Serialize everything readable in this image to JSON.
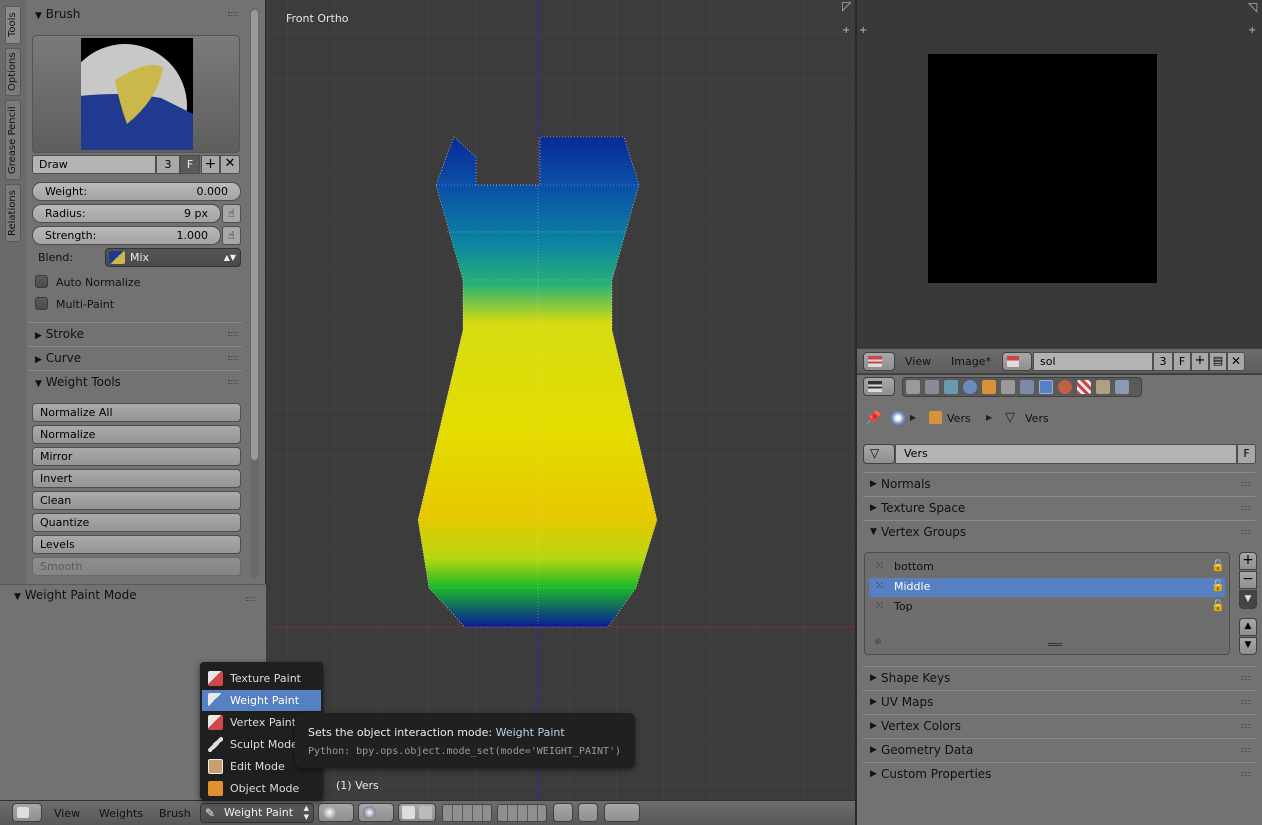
{
  "tool_shelf": {
    "tabs": [
      "Tools",
      "Options",
      "Grease Pencil",
      "Relations"
    ],
    "brush_panel": {
      "title": "Brush",
      "brush_name": "Draw",
      "users": "3",
      "fake_user": "F",
      "weight_label": "Weight:",
      "weight_value": "0.000",
      "radius_label": "Radius:",
      "radius_value": "9 px",
      "strength_label": "Strength:",
      "strength_value": "1.000",
      "blend_label": "Blend:",
      "blend_value": "Mix",
      "auto_normalize": "Auto Normalize",
      "multi_paint": "Multi-Paint"
    },
    "stroke_panel": "Stroke",
    "curve_panel": "Curve",
    "weight_tools_panel": {
      "title": "Weight Tools",
      "buttons": [
        "Normalize All",
        "Normalize",
        "Mirror",
        "Invert",
        "Clean",
        "Quantize",
        "Levels",
        "Smooth"
      ]
    },
    "operator_panel": "Weight Paint Mode"
  },
  "viewport": {
    "view_label": "Front Ortho",
    "object_label": "(1) Vers"
  },
  "mode_menu": {
    "items": [
      "Texture Paint",
      "Weight Paint",
      "Vertex Paint",
      "Sculpt Mode",
      "Edit Mode",
      "Object Mode"
    ],
    "selected": "Weight Paint"
  },
  "tooltip": {
    "text": "Sets the object interaction mode:",
    "value": "Weight Paint",
    "python": "Python: bpy.ops.object.mode_set(mode='WEIGHT_PAINT')"
  },
  "bottom_header": {
    "menus": [
      "View",
      "Weights",
      "Brush"
    ],
    "mode": "Weight Paint"
  },
  "image_editor_header": {
    "menus": [
      "View",
      "Image*"
    ],
    "image_name": "sol",
    "users": "3",
    "fake_user": "F"
  },
  "properties": {
    "breadcrumb": [
      "Vers",
      "Vers"
    ],
    "mesh_name": "Vers",
    "fake_user": "F",
    "panels_top": [
      "Normals",
      "Texture Space"
    ],
    "vertex_groups_title": "Vertex Groups",
    "vertex_groups": [
      "bottom",
      "Middle",
      "Top"
    ],
    "selected_group": "Middle",
    "panels_bottom": [
      "Shape Keys",
      "UV Maps",
      "Vertex Colors",
      "Geometry Data",
      "Custom Properties"
    ]
  },
  "colors": {
    "selection_blue": "#5680c2",
    "panel_gray": "#727272",
    "viewport_bg": "#3c3c3c",
    "weight_low": "#0a1e9a",
    "weight_high": "#e6dc00"
  }
}
